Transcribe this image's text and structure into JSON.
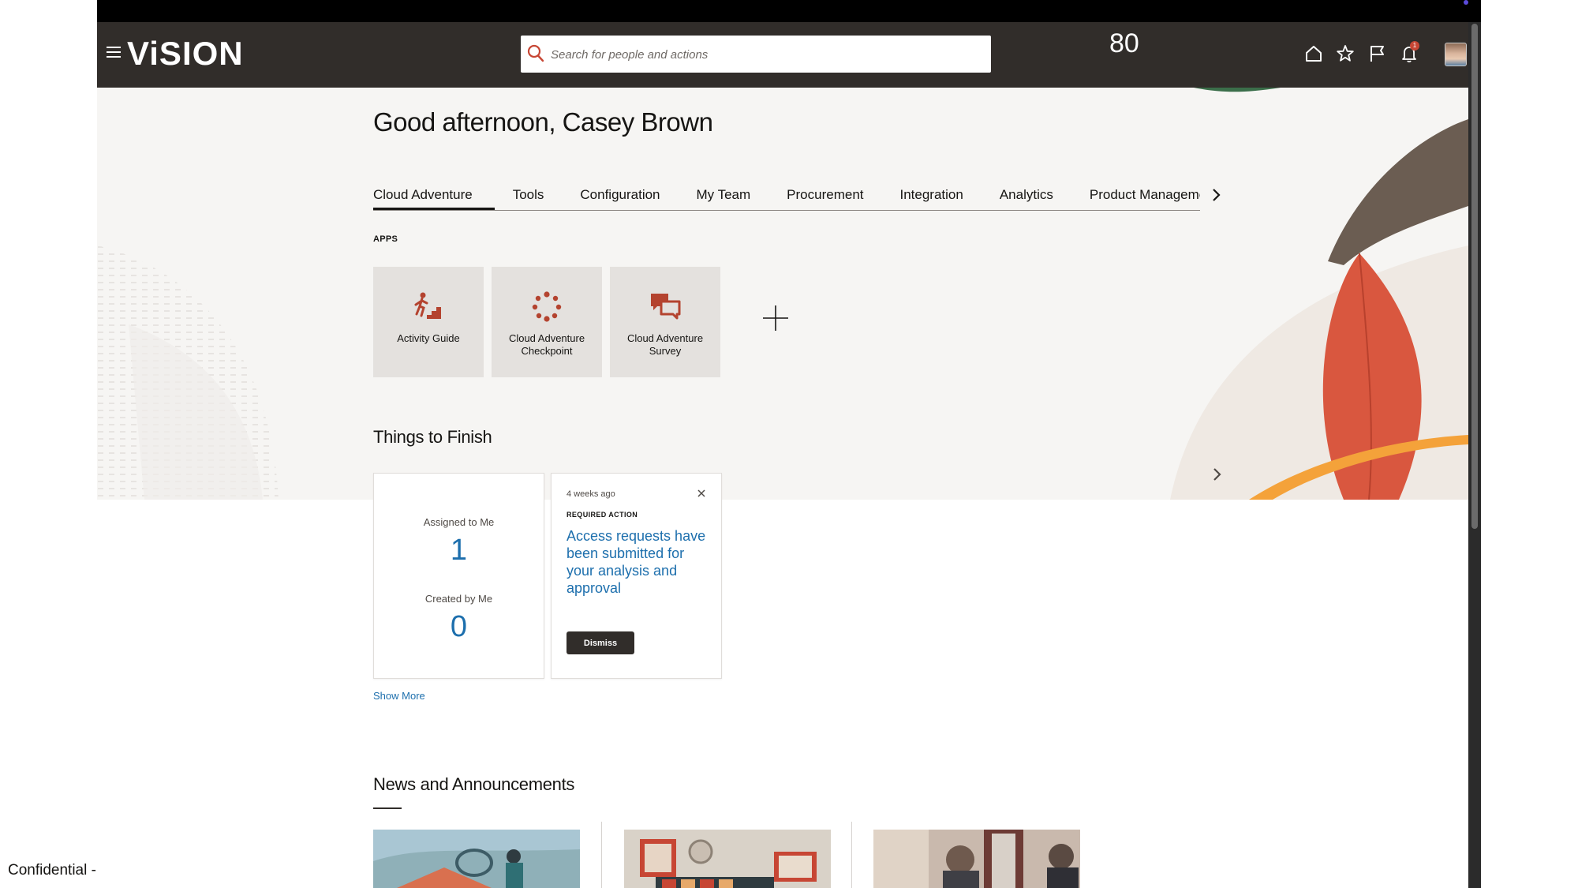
{
  "header": {
    "logo": "ViSION",
    "search_placeholder": "Search for people and actions",
    "zoom_level": "80",
    "notification_count": "1",
    "icons": [
      "menu-icon",
      "search-icon",
      "home-icon",
      "star-icon",
      "flag-icon",
      "bell-icon",
      "avatar"
    ]
  },
  "greeting": "Good afternoon, Casey Brown",
  "tabs": [
    {
      "label": "Cloud Adventure",
      "active": true
    },
    {
      "label": "Tools"
    },
    {
      "label": "Configuration"
    },
    {
      "label": "My Team"
    },
    {
      "label": "Procurement"
    },
    {
      "label": "Integration"
    },
    {
      "label": "Analytics"
    },
    {
      "label": "Product Manageme"
    }
  ],
  "apps": {
    "label": "APPS",
    "tiles": [
      {
        "label": "Activity Guide",
        "icon": "stairs-person-icon"
      },
      {
        "label": "Cloud Adventure Checkpoint",
        "icon": "circle-dots-icon"
      },
      {
        "label": "Cloud Adventure Survey",
        "icon": "chat-bubbles-icon"
      }
    ]
  },
  "things_to_finish": {
    "title": "Things to Finish",
    "assigned_label": "Assigned to Me",
    "assigned_count": "1",
    "created_label": "Created by Me",
    "created_count": "0",
    "notification": {
      "time": "4 weeks ago",
      "tag": "REQUIRED ACTION",
      "text": "Access requests have been submitted for your analysis and approval",
      "dismiss": "Dismiss"
    },
    "show_more": "Show More"
  },
  "news": {
    "title": "News and Announcements"
  },
  "footer": {
    "confidential": "Confidential -"
  },
  "colors": {
    "header": "#312d2a",
    "accent_link": "#1d6fad",
    "app_icon": "#b4432f",
    "hero_bg": "#f6f5f3",
    "tile_bg": "#e4e1de"
  }
}
